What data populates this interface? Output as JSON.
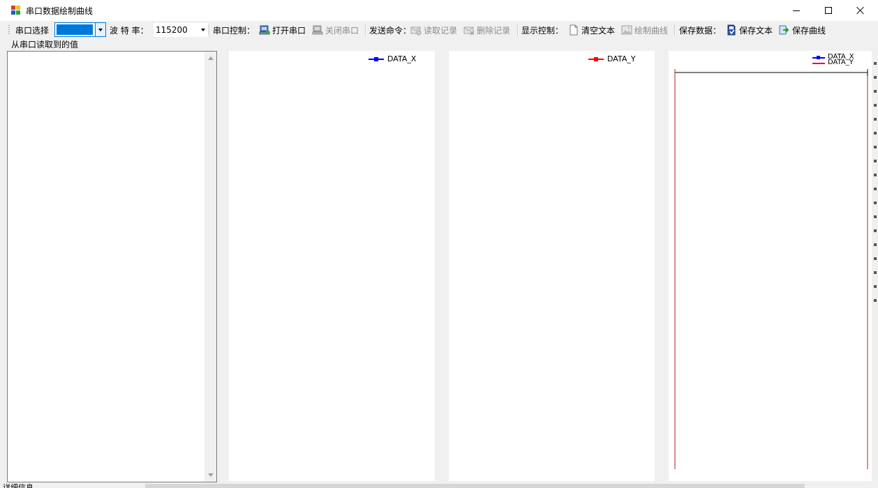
{
  "window": {
    "title": "串口数据绘制曲线",
    "icon": "app-chart-icon"
  },
  "toolbar": {
    "port_label": "串口选择",
    "port_value": "",
    "baud_label": "波 特 率：",
    "baud_value": "115200",
    "serial_ctrl_label": "串口控制：",
    "open_port": "打开串口",
    "close_port": "关闭串口",
    "send_cmd_label": "发送命令：",
    "read_record": "读取记录",
    "delete_record": "删除记录",
    "display_ctrl_label": "显示控制：",
    "clear_text": "清空文本",
    "draw_curve": "绘制曲线",
    "save_data_label": "保存数据：",
    "save_text": "保存文本",
    "save_curve": "保存曲线"
  },
  "text_panel": {
    "label": "从串口读取到的值"
  },
  "charts": {
    "x": {
      "legend": "DATA_X",
      "color": "#0000ff"
    },
    "y": {
      "legend": "DATA_Y",
      "color": "#ff0000"
    },
    "xy": {
      "legend_x": "DATA_X",
      "legend_y": "DATA_Y"
    }
  },
  "chart_data": [
    {
      "type": "line",
      "series": [
        {
          "name": "DATA_X",
          "values": []
        }
      ]
    },
    {
      "type": "line",
      "series": [
        {
          "name": "DATA_Y",
          "values": []
        }
      ]
    },
    {
      "type": "line",
      "series": [
        {
          "name": "DATA_X",
          "values": []
        },
        {
          "name": "DATA_Y",
          "values": []
        }
      ]
    }
  ],
  "status": {
    "bottom_label": "详细信息"
  }
}
